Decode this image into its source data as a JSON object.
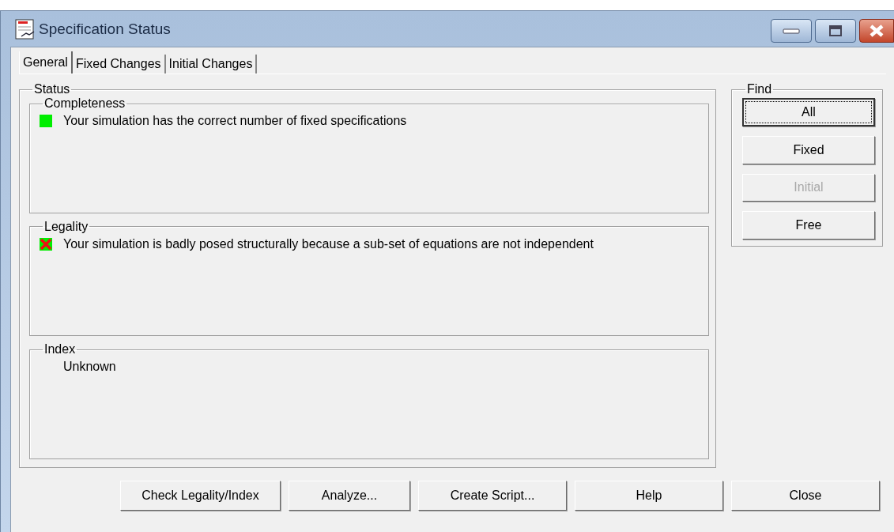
{
  "window": {
    "title": "Specification Status"
  },
  "tabs": [
    {
      "label": "General",
      "selected": true
    },
    {
      "label": "Fixed Changes",
      "selected": false
    },
    {
      "label": "Initial Changes",
      "selected": false
    }
  ],
  "status": {
    "title": "Status",
    "sections": [
      {
        "title": "Completeness",
        "kind": "ok",
        "message": "Your simulation has the correct number of fixed specifications"
      },
      {
        "title": "Legality",
        "kind": "error",
        "message": "Your simulation is badly posed structurally because a sub-set of equations are not independent"
      },
      {
        "title": "Index",
        "kind": "plain",
        "message": "Unknown"
      }
    ]
  },
  "find": {
    "title": "Find",
    "buttons": [
      {
        "label": "All",
        "focused": true,
        "disabled": false
      },
      {
        "label": "Fixed",
        "focused": false,
        "disabled": false
      },
      {
        "label": "Initial",
        "focused": false,
        "disabled": true
      },
      {
        "label": "Free",
        "focused": false,
        "disabled": false
      }
    ]
  },
  "buttons": [
    "Check Legality/Index",
    "Analyze...",
    "Create Script...",
    "Help",
    "Close"
  ]
}
